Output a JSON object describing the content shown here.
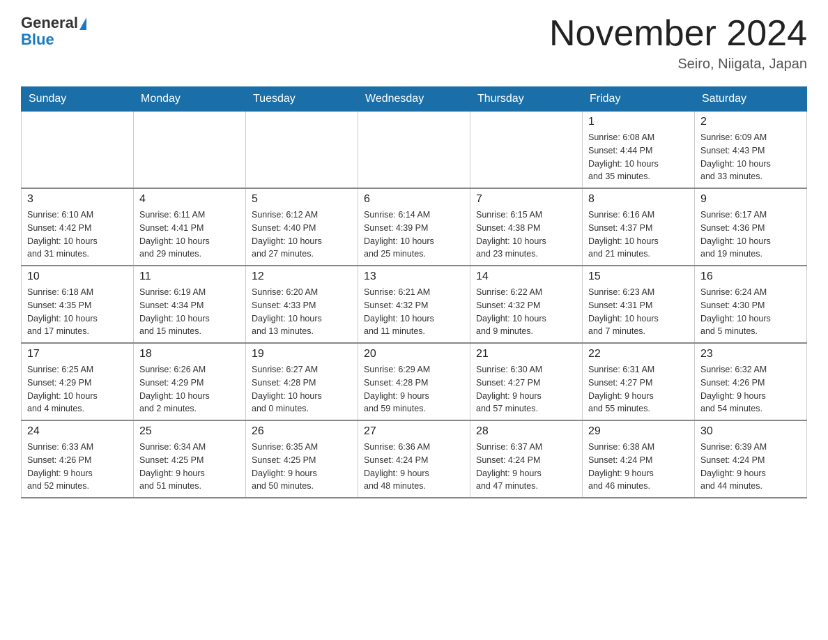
{
  "header": {
    "logo_general": "General",
    "logo_blue": "Blue",
    "main_title": "November 2024",
    "subtitle": "Seiro, Niigata, Japan"
  },
  "weekdays": [
    "Sunday",
    "Monday",
    "Tuesday",
    "Wednesday",
    "Thursday",
    "Friday",
    "Saturday"
  ],
  "weeks": [
    [
      {
        "day": "",
        "info": ""
      },
      {
        "day": "",
        "info": ""
      },
      {
        "day": "",
        "info": ""
      },
      {
        "day": "",
        "info": ""
      },
      {
        "day": "",
        "info": ""
      },
      {
        "day": "1",
        "info": "Sunrise: 6:08 AM\nSunset: 4:44 PM\nDaylight: 10 hours\nand 35 minutes."
      },
      {
        "day": "2",
        "info": "Sunrise: 6:09 AM\nSunset: 4:43 PM\nDaylight: 10 hours\nand 33 minutes."
      }
    ],
    [
      {
        "day": "3",
        "info": "Sunrise: 6:10 AM\nSunset: 4:42 PM\nDaylight: 10 hours\nand 31 minutes."
      },
      {
        "day": "4",
        "info": "Sunrise: 6:11 AM\nSunset: 4:41 PM\nDaylight: 10 hours\nand 29 minutes."
      },
      {
        "day": "5",
        "info": "Sunrise: 6:12 AM\nSunset: 4:40 PM\nDaylight: 10 hours\nand 27 minutes."
      },
      {
        "day": "6",
        "info": "Sunrise: 6:14 AM\nSunset: 4:39 PM\nDaylight: 10 hours\nand 25 minutes."
      },
      {
        "day": "7",
        "info": "Sunrise: 6:15 AM\nSunset: 4:38 PM\nDaylight: 10 hours\nand 23 minutes."
      },
      {
        "day": "8",
        "info": "Sunrise: 6:16 AM\nSunset: 4:37 PM\nDaylight: 10 hours\nand 21 minutes."
      },
      {
        "day": "9",
        "info": "Sunrise: 6:17 AM\nSunset: 4:36 PM\nDaylight: 10 hours\nand 19 minutes."
      }
    ],
    [
      {
        "day": "10",
        "info": "Sunrise: 6:18 AM\nSunset: 4:35 PM\nDaylight: 10 hours\nand 17 minutes."
      },
      {
        "day": "11",
        "info": "Sunrise: 6:19 AM\nSunset: 4:34 PM\nDaylight: 10 hours\nand 15 minutes."
      },
      {
        "day": "12",
        "info": "Sunrise: 6:20 AM\nSunset: 4:33 PM\nDaylight: 10 hours\nand 13 minutes."
      },
      {
        "day": "13",
        "info": "Sunrise: 6:21 AM\nSunset: 4:32 PM\nDaylight: 10 hours\nand 11 minutes."
      },
      {
        "day": "14",
        "info": "Sunrise: 6:22 AM\nSunset: 4:32 PM\nDaylight: 10 hours\nand 9 minutes."
      },
      {
        "day": "15",
        "info": "Sunrise: 6:23 AM\nSunset: 4:31 PM\nDaylight: 10 hours\nand 7 minutes."
      },
      {
        "day": "16",
        "info": "Sunrise: 6:24 AM\nSunset: 4:30 PM\nDaylight: 10 hours\nand 5 minutes."
      }
    ],
    [
      {
        "day": "17",
        "info": "Sunrise: 6:25 AM\nSunset: 4:29 PM\nDaylight: 10 hours\nand 4 minutes."
      },
      {
        "day": "18",
        "info": "Sunrise: 6:26 AM\nSunset: 4:29 PM\nDaylight: 10 hours\nand 2 minutes."
      },
      {
        "day": "19",
        "info": "Sunrise: 6:27 AM\nSunset: 4:28 PM\nDaylight: 10 hours\nand 0 minutes."
      },
      {
        "day": "20",
        "info": "Sunrise: 6:29 AM\nSunset: 4:28 PM\nDaylight: 9 hours\nand 59 minutes."
      },
      {
        "day": "21",
        "info": "Sunrise: 6:30 AM\nSunset: 4:27 PM\nDaylight: 9 hours\nand 57 minutes."
      },
      {
        "day": "22",
        "info": "Sunrise: 6:31 AM\nSunset: 4:27 PM\nDaylight: 9 hours\nand 55 minutes."
      },
      {
        "day": "23",
        "info": "Sunrise: 6:32 AM\nSunset: 4:26 PM\nDaylight: 9 hours\nand 54 minutes."
      }
    ],
    [
      {
        "day": "24",
        "info": "Sunrise: 6:33 AM\nSunset: 4:26 PM\nDaylight: 9 hours\nand 52 minutes."
      },
      {
        "day": "25",
        "info": "Sunrise: 6:34 AM\nSunset: 4:25 PM\nDaylight: 9 hours\nand 51 minutes."
      },
      {
        "day": "26",
        "info": "Sunrise: 6:35 AM\nSunset: 4:25 PM\nDaylight: 9 hours\nand 50 minutes."
      },
      {
        "day": "27",
        "info": "Sunrise: 6:36 AM\nSunset: 4:24 PM\nDaylight: 9 hours\nand 48 minutes."
      },
      {
        "day": "28",
        "info": "Sunrise: 6:37 AM\nSunset: 4:24 PM\nDaylight: 9 hours\nand 47 minutes."
      },
      {
        "day": "29",
        "info": "Sunrise: 6:38 AM\nSunset: 4:24 PM\nDaylight: 9 hours\nand 46 minutes."
      },
      {
        "day": "30",
        "info": "Sunrise: 6:39 AM\nSunset: 4:24 PM\nDaylight: 9 hours\nand 44 minutes."
      }
    ]
  ]
}
